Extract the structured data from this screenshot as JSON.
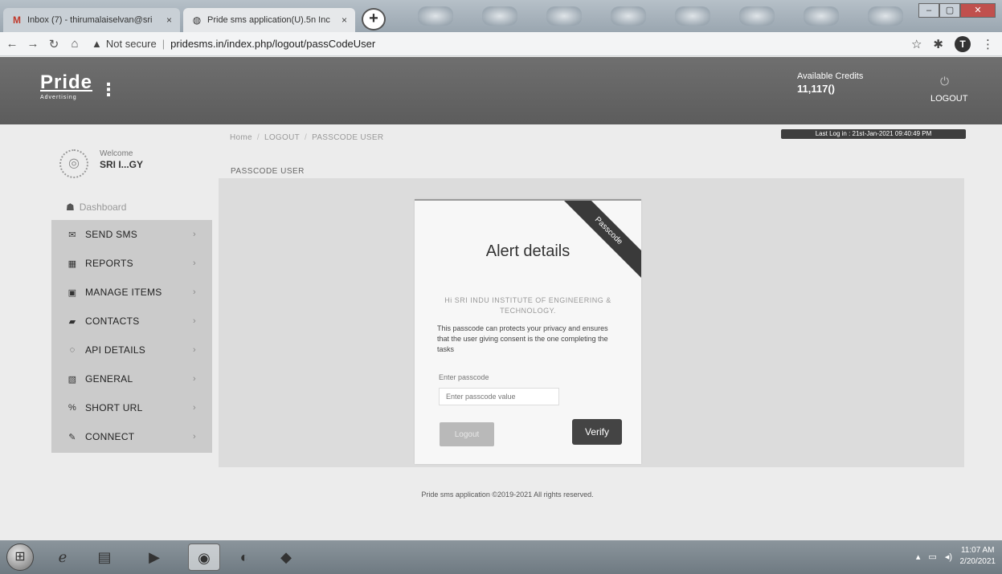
{
  "browser": {
    "tabs": [
      {
        "label": "Inbox (7) - thirumalaiselvan@sri",
        "icon": "gmail-icon"
      },
      {
        "label": "Pride sms application(U).5n Inc",
        "icon": "globe-icon"
      }
    ],
    "close_glyph": "×",
    "new_tab_glyph": "+",
    "security_label": "Not secure",
    "url": "pridesms.in/index.php/logout/passCodeUser",
    "profile_initial": "T"
  },
  "header": {
    "logo_text": "Pride",
    "logo_sub": "Advertising",
    "credits_label": "Available Credits",
    "credits_value": "11,117()",
    "logout_label": "LOGOUT",
    "last_login": "Last Log in : 21st-Jan-2021 09:40:49 PM"
  },
  "sidebar": {
    "welcome_label": "Welcome",
    "user_name": "SRI I...GY",
    "dashboard_label": "Dashboard",
    "items": [
      {
        "label": "SEND SMS",
        "icon": "envelope-icon"
      },
      {
        "label": "REPORTS",
        "icon": "table-icon"
      },
      {
        "label": "MANAGE ITEMS",
        "icon": "list-icon"
      },
      {
        "label": "CONTACTS",
        "icon": "book-icon"
      },
      {
        "label": "API DETAILS",
        "icon": "api-icon"
      },
      {
        "label": "GENERAL",
        "icon": "image-icon"
      },
      {
        "label": "SHORT URL",
        "icon": "link-icon"
      },
      {
        "label": "CONNECT",
        "icon": "plug-icon"
      }
    ]
  },
  "breadcrumb": {
    "items": [
      "Home",
      "LOGOUT",
      "PASSCODE USER"
    ],
    "separator": "/"
  },
  "page": {
    "title": "PASSCODE USER"
  },
  "modal": {
    "ribbon": "Passcode",
    "title": "Alert details",
    "greeting": "Hi SRI INDU INSTITUTE OF ENGINEERING & TECHNOLOGY.",
    "description": "This passcode can protects your privacy and ensures that the user giving consent is the one completing the tasks",
    "passcode_label": "Enter passcode",
    "passcode_placeholder": "Enter passcode value",
    "passcode_value": "",
    "logout_button": "Logout",
    "verify_button": "Verify"
  },
  "footer": {
    "text": "Pride sms application ©2019-2021 All rights reserved."
  },
  "taskbar": {
    "time": "11:07 AM",
    "date": "2/20/2021"
  }
}
